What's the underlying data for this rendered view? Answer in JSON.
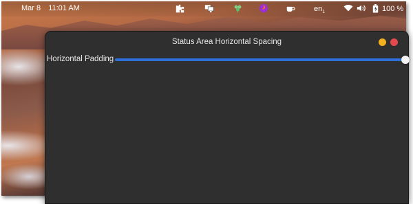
{
  "topbar": {
    "date": "Mar 8",
    "time": "11:01 AM",
    "icons": {
      "extensions": "puzzle-icon",
      "screens": "display-icon",
      "app1": "clover-icon",
      "app2": "firefox-icon",
      "app3": "cup-icon",
      "wifi": "wifi-icon",
      "volume": "volume-icon",
      "battery": "battery-icon"
    },
    "language": "en",
    "language_sub": "1",
    "battery_percent": "100 %"
  },
  "window": {
    "title": "Status Area Horizontal Spacing",
    "setting_label": "Horizontal Padding",
    "slider_value_fraction": 1.0,
    "colors": {
      "minimize": "#f2b01e",
      "close": "#e5484d",
      "slider_fill": "#2f6fd8"
    }
  }
}
